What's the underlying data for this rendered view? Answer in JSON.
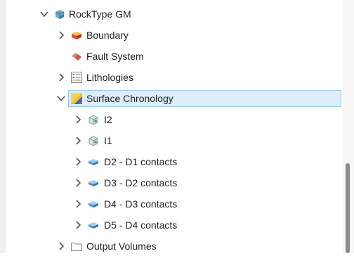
{
  "tree": {
    "items": [
      {
        "label": "RockType GM",
        "icon": "geological-model-icon",
        "expanded": true
      },
      {
        "label": "Boundary",
        "icon": "boundary-icon",
        "expanded": false
      },
      {
        "label": "Fault System",
        "icon": "fault-system-icon"
      },
      {
        "label": "Lithologies",
        "icon": "lithologies-list-icon",
        "expanded": false
      },
      {
        "label": "Surface Chronology",
        "icon": "surface-chronology-icon",
        "expanded": true,
        "selected": true
      },
      {
        "label": "I2",
        "icon": "intrusion-icon",
        "expanded": false
      },
      {
        "label": "I1",
        "icon": "intrusion-icon",
        "expanded": false
      },
      {
        "label": "D2 - D1 contacts",
        "icon": "deposit-contact-icon",
        "expanded": false
      },
      {
        "label": "D3 - D2 contacts",
        "icon": "deposit-contact-icon",
        "expanded": false
      },
      {
        "label": "D4 - D3 contacts",
        "icon": "deposit-contact-icon",
        "expanded": false
      },
      {
        "label": "D5 - D4 contacts",
        "icon": "deposit-contact-icon",
        "expanded": false
      },
      {
        "label": "Output Volumes",
        "icon": "folder-icon",
        "expanded": false
      }
    ]
  },
  "colors": {
    "selection_bg": "#dceefb",
    "selection_border": "#9bc9ee",
    "scrollbar_thumb": "#8c8c8c"
  }
}
